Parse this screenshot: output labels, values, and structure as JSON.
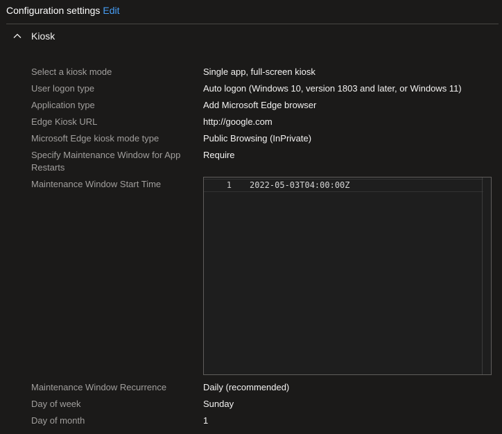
{
  "header": {
    "title": "Configuration settings",
    "edit_label": "Edit"
  },
  "section": {
    "title": "Kiosk",
    "expanded": true,
    "icon": "chevron-up-icon"
  },
  "settings": [
    {
      "label": "Select a kiosk mode",
      "value": "Single app, full-screen kiosk"
    },
    {
      "label": "User logon type",
      "value": "Auto logon (Windows 10, version 1803 and later, or Windows 11)"
    },
    {
      "label": "Application type",
      "value": "Add Microsoft Edge browser"
    },
    {
      "label": "Edge Kiosk URL",
      "value": "http://google.com"
    },
    {
      "label": "Microsoft Edge kiosk mode type",
      "value": "Public Browsing (InPrivate)"
    },
    {
      "label": "Specify Maintenance Window for App Restarts",
      "value": "Require"
    },
    {
      "label": "Maintenance Window Start Time",
      "value": ""
    },
    {
      "label": "Maintenance Window Recurrence",
      "value": "Daily (recommended)"
    },
    {
      "label": "Day of week",
      "value": "Sunday"
    },
    {
      "label": "Day of month",
      "value": "1"
    }
  ],
  "editor": {
    "line_number": "1",
    "code": "2022-05-03T04:00:00Z"
  },
  "colors": {
    "background": "#1b1a19",
    "label": "#a19f9d",
    "value": "#f3f2f1",
    "link": "#479ef5"
  }
}
